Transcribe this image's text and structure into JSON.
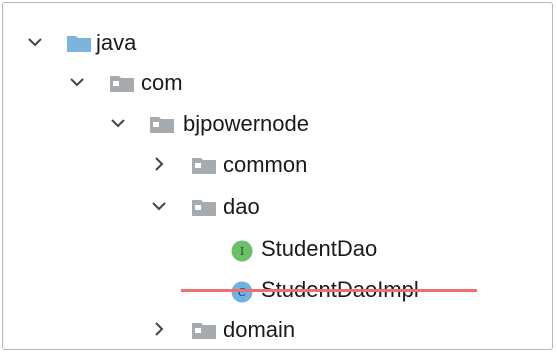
{
  "tree": {
    "items": [
      {
        "label": "java",
        "expanded": true,
        "icon": "source-folder-icon",
        "color": "#7cb4dc"
      },
      {
        "label": "com",
        "expanded": true,
        "icon": "package-folder-icon"
      },
      {
        "label": "bjpowernode",
        "expanded": true,
        "icon": "package-folder-icon"
      },
      {
        "label": "common",
        "expanded": false,
        "icon": "package-folder-icon"
      },
      {
        "label": "dao",
        "expanded": true,
        "icon": "package-folder-icon"
      },
      {
        "label": "StudentDao",
        "icon": "interface-icon",
        "badge": "I",
        "color": "#6bbf6b"
      },
      {
        "label": "StudentDaoImpl",
        "icon": "class-icon",
        "badge": "C",
        "color": "#6fb3e0",
        "strikethrough": true
      },
      {
        "label": "domain",
        "expanded": false,
        "icon": "package-folder-icon"
      }
    ]
  }
}
